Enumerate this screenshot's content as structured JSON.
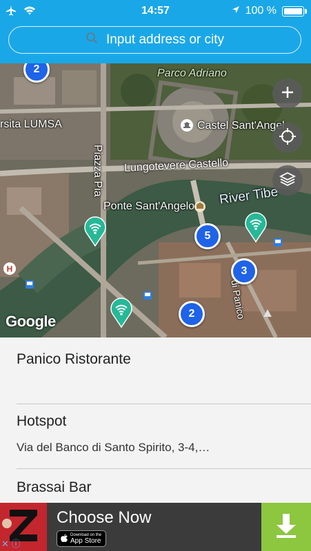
{
  "status": {
    "time": "14:57",
    "battery": "100 %",
    "icons": [
      "airplane-icon",
      "wifi-icon",
      "location-arrow-icon",
      "battery-icon"
    ]
  },
  "search": {
    "placeholder": "Input address or city",
    "icon": "search-icon"
  },
  "map": {
    "labels": {
      "parco": "Parco Adriano",
      "castel": "Castel Sant'Angel",
      "lumsa": "rsita LUMSA",
      "piazza": "Piazza Pia",
      "lungotevere": "Lungotevere Castello",
      "river": "River Tibe",
      "ponte": "Ponte Sant'Angelo",
      "panico": "di Panico"
    },
    "clusters": {
      "c1": "2",
      "c2": "5",
      "c3": "3",
      "c4": "2"
    },
    "attribution": "Google",
    "controls": [
      "zoom-in-icon",
      "locate-icon",
      "layers-icon"
    ]
  },
  "results": [
    {
      "title": "Panico Ristorante",
      "subtitle": ""
    },
    {
      "title": "Hotspot",
      "subtitle": "Via del Banco di Santo Spirito, 3-4,…"
    },
    {
      "title": "Brassai Bar",
      "subtitle": ""
    }
  ],
  "ad": {
    "headline": "Choose Now",
    "store_small": "Download on the",
    "store_big": "App Store"
  },
  "colors": {
    "header": "#1aa7e8",
    "cluster": "#1e63e8",
    "pin": "#26b897",
    "download": "#8dc63f"
  }
}
